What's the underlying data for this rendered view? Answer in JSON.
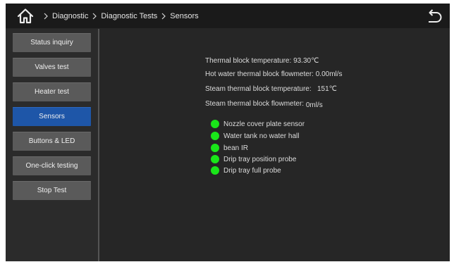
{
  "breadcrumb": [
    "Diagnostic",
    "Diagnostic Tests",
    "Sensors"
  ],
  "sidebar": {
    "items": [
      {
        "label": "Status inquiry",
        "active": false
      },
      {
        "label": "Valves test",
        "active": false
      },
      {
        "label": "Heater test",
        "active": false
      },
      {
        "label": "Sensors",
        "active": true
      },
      {
        "label": "Buttons & LED",
        "active": false
      },
      {
        "label": "One-click testing",
        "active": false
      },
      {
        "label": "Stop Test",
        "active": false
      }
    ]
  },
  "readings": [
    {
      "label": "Thermal block temperature:",
      "value": "93.30℃"
    },
    {
      "label": "Hot water thermal block flowmeter:",
      "value": "0.00ml/s"
    },
    {
      "label": "Steam thermal block temperature:",
      "value": "151℃"
    },
    {
      "label": "Steam thermal block flowmeter:",
      "value": "0ml/s"
    }
  ],
  "sensors": [
    {
      "label": "Nozzle cover plate sensor",
      "status_color": "#19e619"
    },
    {
      "label": "Water tank no water hall",
      "status_color": "#19e619"
    },
    {
      "label": "bean IR",
      "status_color": "#19e619"
    },
    {
      "label": "Drip tray position probe",
      "status_color": "#19e619"
    },
    {
      "label": "Drip tray full probe",
      "status_color": "#19e619"
    }
  ],
  "icons": {
    "home": "home-icon",
    "back": "back-arrow-icon",
    "separator": "chevron-right-icon"
  },
  "colors": {
    "active_nav": "#1e56a8",
    "nav": "#5a5a5a",
    "status_ok": "#19e619",
    "background": "#262626"
  }
}
